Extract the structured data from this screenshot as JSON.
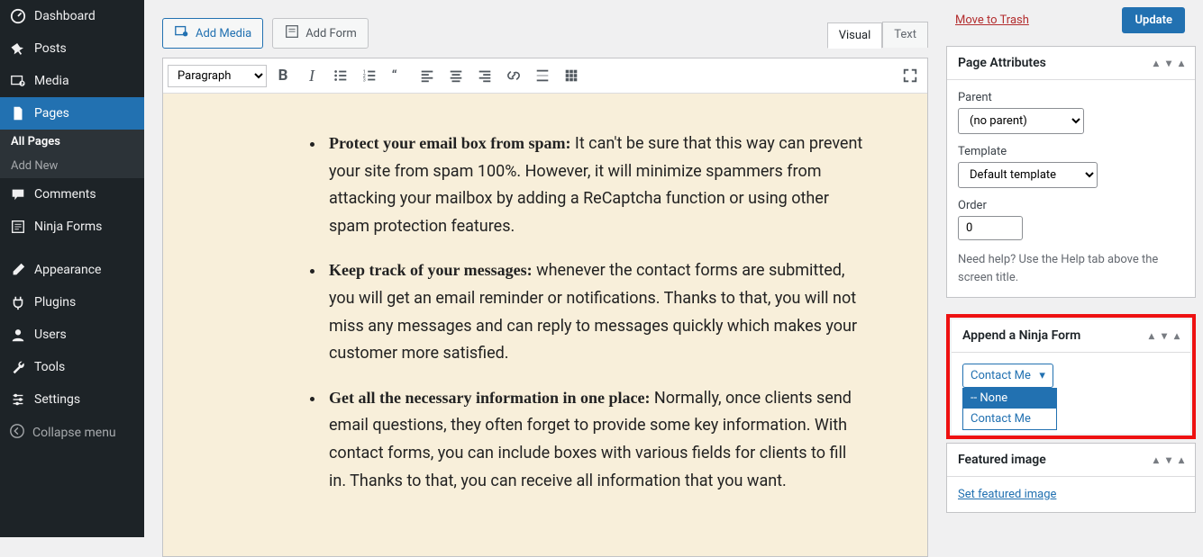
{
  "sidebar": {
    "dashboard": "Dashboard",
    "posts": "Posts",
    "media": "Media",
    "pages": "Pages",
    "all_pages": "All Pages",
    "add_new": "Add New",
    "comments": "Comments",
    "ninja_forms": "Ninja Forms",
    "appearance": "Appearance",
    "plugins": "Plugins",
    "users": "Users",
    "tools": "Tools",
    "settings": "Settings",
    "collapse": "Collapse menu"
  },
  "toolbar": {
    "add_media": "Add Media",
    "add_form": "Add Form",
    "visual_tab": "Visual",
    "text_tab": "Text",
    "format_select": "Paragraph"
  },
  "content": {
    "li1_b": "Protect your email box from spam:",
    "li1_t": " It can't be sure that this way can prevent your site from spam 100%. However, it will minimize spammers from attacking your mailbox by adding a ReCaptcha function or using other spam protection features.",
    "li2_b": "Keep track of your messages:",
    "li2_t": " whenever the contact forms are submitted, you will get an email reminder or notifications. Thanks to that, you will not miss any messages and can reply to messages quickly which makes your customer more satisfied.",
    "li3_b": "Get all the necessary information in one place:",
    "li3_t": " Normally, once clients send email questions, they often forget to provide some key information. With contact forms, you can include boxes with various fields for clients to fill in. Thanks to that, you can receive all information that you want."
  },
  "publish": {
    "trash": "Move to Trash",
    "update": "Update"
  },
  "page_attr": {
    "title": "Page Attributes",
    "parent_label": "Parent",
    "parent_value": "(no parent)",
    "template_label": "Template",
    "template_value": "Default template",
    "order_label": "Order",
    "order_value": "0",
    "help": "Need help? Use the Help tab above the screen title."
  },
  "ninja": {
    "title": "Append a Ninja Form",
    "selected": "Contact Me",
    "opt_none": "-- None",
    "opt_contact": "Contact Me"
  },
  "featured": {
    "title": "Featured image",
    "link": "Set featured image"
  }
}
